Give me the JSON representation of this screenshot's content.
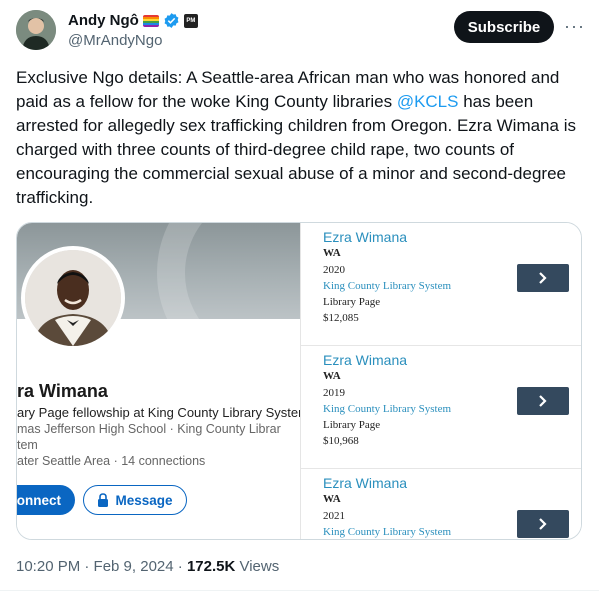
{
  "author": {
    "display_name": "Andy Ngô",
    "handle": "@MrAndyNgo",
    "badge_text": "PM",
    "subscribe_label": "Subscribe",
    "more_label": "···"
  },
  "tweet": {
    "text_before": "Exclusive Ngo details: A Seattle-area African man who was honored and paid as a fellow for the woke King County libraries ",
    "mention": "@KCLS",
    "text_after": " has been arrested for allegedly sex trafficking children from Oregon. Ezra Wimana is charged with three counts of third-degree child rape, two counts of encouraging the commercial sexual abuse of a minor and second-degree trafficking."
  },
  "profile_card": {
    "name": "ra Wimana",
    "headline": "ary Page fellowship at King County Library Syster",
    "school": "mas Jefferson High School · King County Librar",
    "school_cont": "tem",
    "location": "ater Seattle Area · 14 connections",
    "connect_label": "onnect",
    "message_label": "Message"
  },
  "records": [
    {
      "name": "Ezra Wimana",
      "state": "WA",
      "year": "2020",
      "org": "King County Library System",
      "page": "Library Page",
      "amount": "$12,085"
    },
    {
      "name": "Ezra Wimana",
      "state": "WA",
      "year": "2019",
      "org": "King County Library System",
      "page": "Library Page",
      "amount": "$10,968"
    },
    {
      "name": "Ezra Wimana",
      "state": "WA",
      "year": "2021",
      "org": "King County Library System",
      "page": "",
      "amount": ""
    }
  ],
  "meta": {
    "time": "10:20 PM · Feb 9, 2024 · ",
    "views_count": "172.5K",
    "views_label": " Views"
  },
  "colors": {
    "accent": "#1d9bf0",
    "linkedin_blue": "#0a66c2",
    "record_link": "#2a8fbd",
    "record_button": "#34495e"
  }
}
